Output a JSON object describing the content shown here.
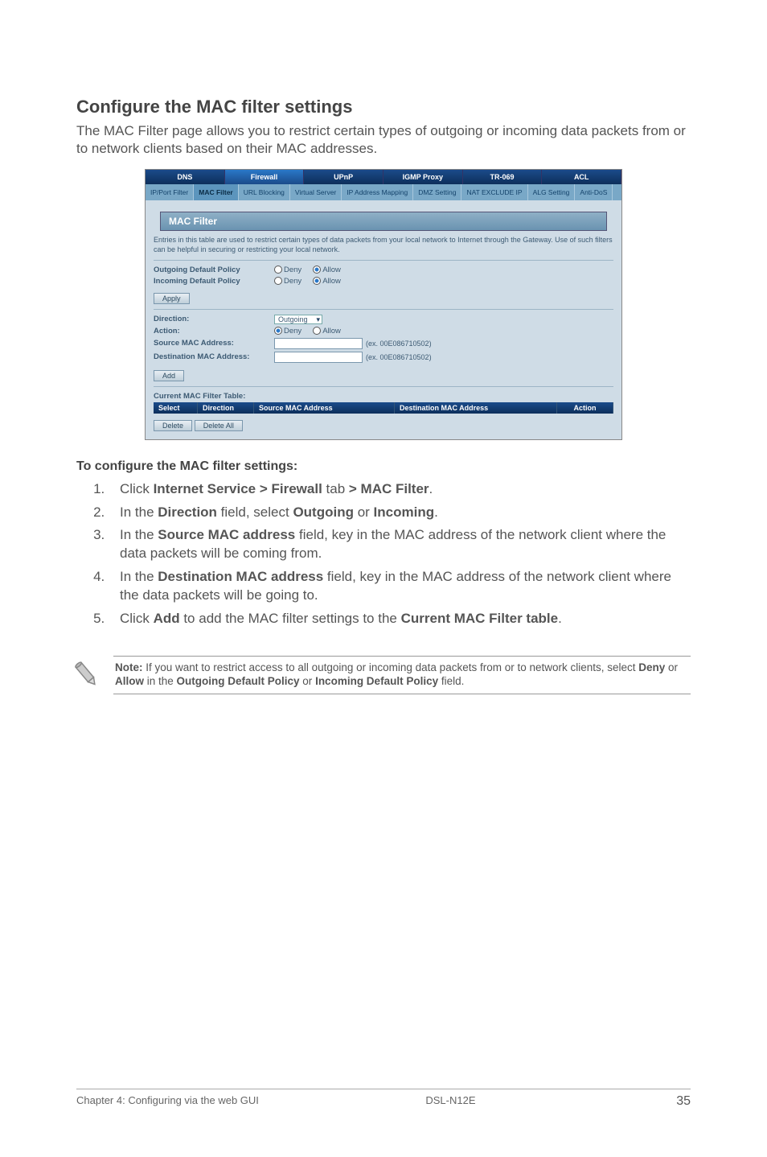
{
  "heading": "Configure the MAC filter settings",
  "intro": "The MAC Filter page allows you to restrict certain types of outgoing or incoming data packets from or to network clients based on their MAC addresses.",
  "screenshot": {
    "tabs": [
      "DNS",
      "Firewall",
      "UPnP",
      "IGMP Proxy",
      "TR-069",
      "ACL"
    ],
    "subtabs": [
      "IP/Port Filter",
      "MAC Filter",
      "URL Blocking",
      "Virtual Server",
      "IP Address Mapping",
      "DMZ Setting",
      "NAT EXCLUDE IP",
      "ALG Setting",
      "Anti-DoS"
    ],
    "panel_title": "MAC Filter",
    "panel_desc": "Entries in this table are used to restrict certain types of data packets from your local network to Internet through the Gateway. Use of such filters can be helpful in securing or restricting your local network.",
    "outgoing_label": "Outgoing Default Policy",
    "incoming_label": "Incoming Default Policy",
    "deny": "Deny",
    "allow": "Allow",
    "apply": "Apply",
    "direction_label": "Direction:",
    "direction_value": "Outgoing",
    "action_label": "Action:",
    "src_label": "Source MAC Address:",
    "dst_label": "Destination MAC Address:",
    "hint": "(ex. 00E086710502)",
    "add": "Add",
    "table_title": "Current MAC Filter Table:",
    "th": [
      "Select",
      "Direction",
      "Source MAC Address",
      "Destination MAC Address",
      "Action"
    ],
    "delete": "Delete",
    "delete_all": "Delete All"
  },
  "steps_title": "To configure the MAC filter settings:",
  "steps": [
    {
      "pre": "Click ",
      "b1": "Internet Service > Firewall",
      "mid": " tab ",
      "b2": "> MAC Filter",
      "post": "."
    },
    {
      "pre": "In the ",
      "b1": "Direction",
      "mid": " field, select ",
      "b2": "Outgoing",
      "mid2": " or ",
      "b3": "Incoming",
      "post": "."
    },
    {
      "pre": "In the ",
      "b1": "Source MAC address",
      "post": " field, key in the MAC address of the network client where the data packets will be coming from."
    },
    {
      "pre": "In the ",
      "b1": "Destination MAC address",
      "post": " field, key in the MAC address of the network client where the data packets will be going to."
    },
    {
      "pre": "Click ",
      "b1": "Add",
      "mid": " to add the MAC filter settings to the ",
      "b2": "Current MAC Filter table",
      "post": "."
    }
  ],
  "note": {
    "lead": "Note:",
    "body": " If you want to restrict access to all outgoing or incoming data packets from or to network clients, select ",
    "b1": "Deny",
    "or": " or ",
    "b2": "Allow",
    "in": " in the ",
    "b3": "Outgoing Default Policy",
    "or2": " or ",
    "b4": "Incoming Default Policy",
    "end": " field."
  },
  "footer": {
    "left": "Chapter 4: Configuring via the web GUI",
    "mid": "DSL-N12E",
    "page": "35"
  }
}
